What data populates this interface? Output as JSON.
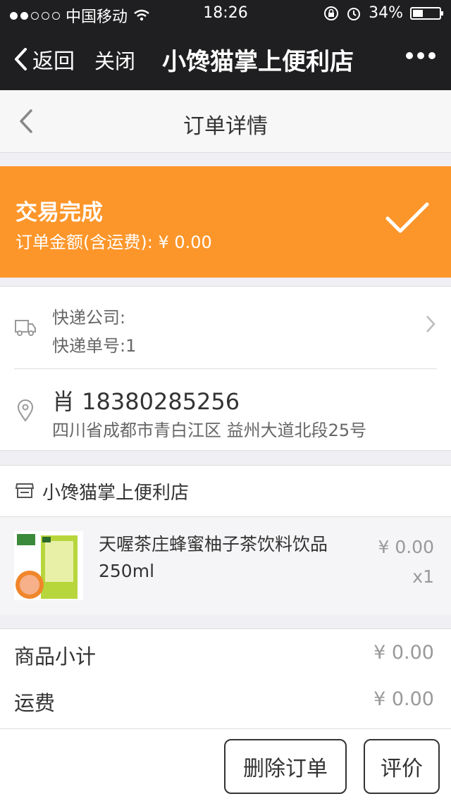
{
  "status_bar": {
    "carrier": "中国移动",
    "time": "18:26",
    "battery": "34%"
  },
  "nav": {
    "back_label": "返回",
    "close_label": "关闭",
    "title": "小馋猫掌上便利店"
  },
  "page": {
    "title": "订单详情"
  },
  "order_status": {
    "title": "交易完成",
    "amount_text": "订单金额(含运费): ¥ 0.00"
  },
  "shipping": {
    "company_line": "快递公司:",
    "tracking_line": "快递单号:1"
  },
  "address": {
    "name_phone": "肖 18380285256",
    "detail": "四川省成都市青白江区 益州大道北段25号"
  },
  "store": {
    "name": "小馋猫掌上便利店"
  },
  "items": [
    {
      "name": "天喔茶庄蜂蜜柚子茶饮料饮品250ml",
      "price": "¥ 0.00",
      "qty": "x1"
    }
  ],
  "totals": {
    "subtotal_label": "商品小计",
    "subtotal_value": "¥ 0.00",
    "shipping_label": "运费",
    "shipping_value": "¥ 0.00"
  },
  "actions": {
    "delete_label": "删除订单",
    "review_label": "评价"
  },
  "colors": {
    "accent": "#fd962a",
    "navbar": "#1f1f21"
  }
}
